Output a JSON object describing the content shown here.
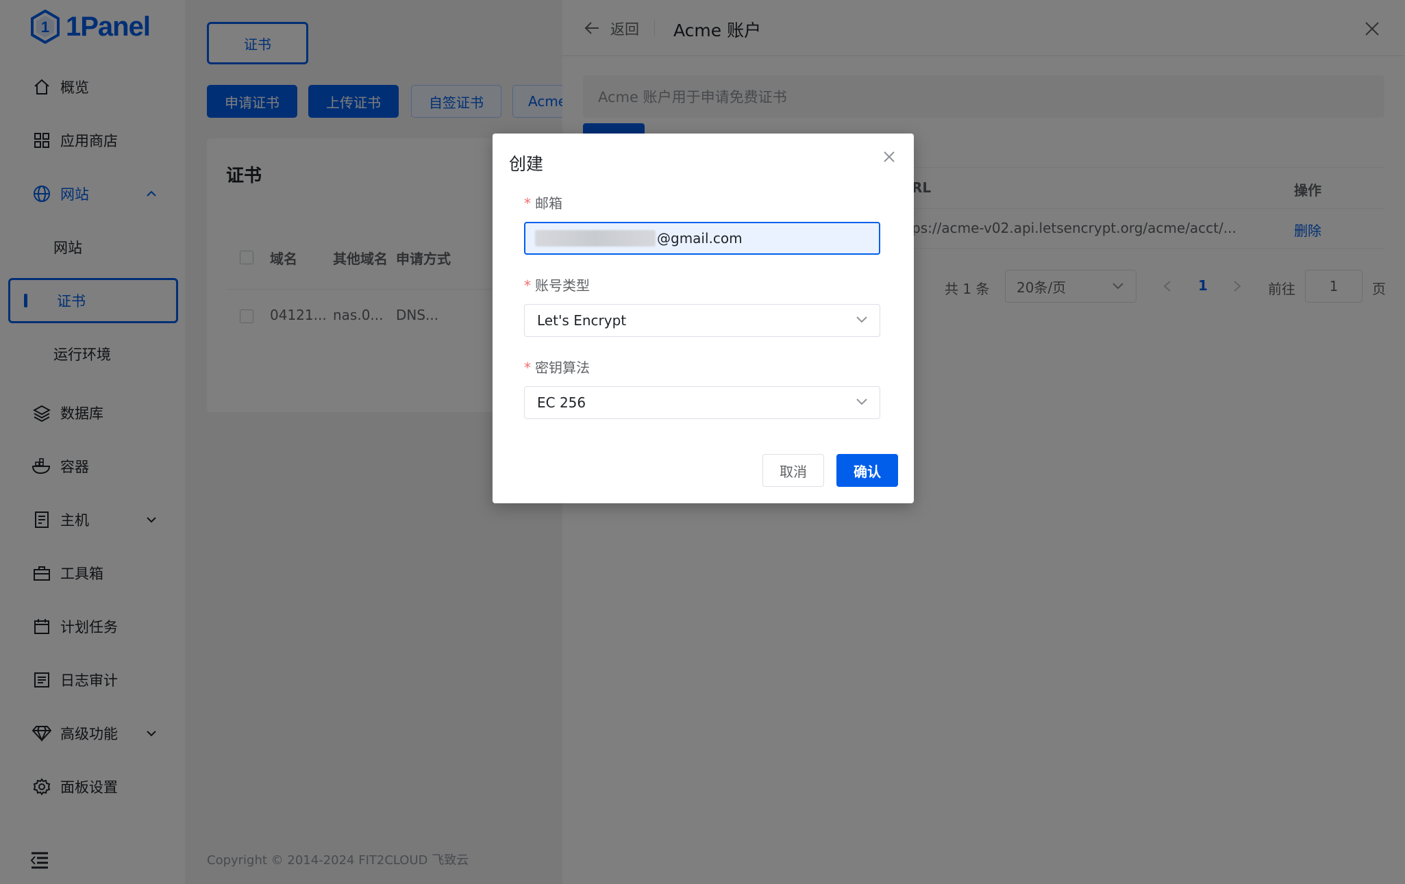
{
  "brand": {
    "name": "1Panel",
    "color": "#005eeb"
  },
  "sidebar": {
    "items": [
      {
        "label": "概览",
        "icon": "home-icon"
      },
      {
        "label": "应用商店",
        "icon": "grid-icon"
      },
      {
        "label": "网站",
        "icon": "globe-icon",
        "expanded": true
      },
      {
        "label": "网站",
        "sub": true
      },
      {
        "label": "证书",
        "sub": true,
        "active": true
      },
      {
        "label": "运行环境",
        "sub": true
      },
      {
        "label": "数据库",
        "icon": "layers-icon"
      },
      {
        "label": "容器",
        "icon": "docker-icon"
      },
      {
        "label": "主机",
        "icon": "server-icon",
        "has_children": true
      },
      {
        "label": "工具箱",
        "icon": "toolbox-icon"
      },
      {
        "label": "计划任务",
        "icon": "calendar-icon"
      },
      {
        "label": "日志审计",
        "icon": "log-icon"
      },
      {
        "label": "高级功能",
        "icon": "diamond-icon",
        "has_children": true
      },
      {
        "label": "面板设置",
        "icon": "gear-icon"
      }
    ]
  },
  "main": {
    "tab_label": "证书",
    "actions": [
      "申请证书",
      "上传证书",
      "自签证书",
      "Acme"
    ],
    "card_title": "证书",
    "table": {
      "headers": [
        "域名",
        "其他域名",
        "申请方式"
      ],
      "rows": [
        [
          "04121...",
          "nas.0...",
          "DNS..."
        ]
      ]
    },
    "copyright": "Copyright © 2014-2024 FIT2CLOUD 飞致云"
  },
  "drawer": {
    "back_label": "返回",
    "title": "Acme 账户",
    "info": "Acme 账户用于申请免费证书",
    "table": {
      "headers": {
        "url": "RL",
        "ops": "操作"
      },
      "row": {
        "url": "ps://acme-v02.api.letsencrypt.org/acme/acct/...",
        "op": "删除"
      }
    },
    "pagination": {
      "total": "共 1 条",
      "page_size": "20条/页",
      "current": "1",
      "goto_label": "前往",
      "goto_value": "1",
      "page_suffix": "页"
    }
  },
  "dialog": {
    "title": "创建",
    "email": {
      "label": "邮箱",
      "value_suffix": "@gmail.com"
    },
    "account_type": {
      "label": "账号类型",
      "value": "Let's Encrypt"
    },
    "key_algorithm": {
      "label": "密钥算法",
      "value": "EC 256"
    },
    "cancel_label": "取消",
    "confirm_label": "确认"
  }
}
